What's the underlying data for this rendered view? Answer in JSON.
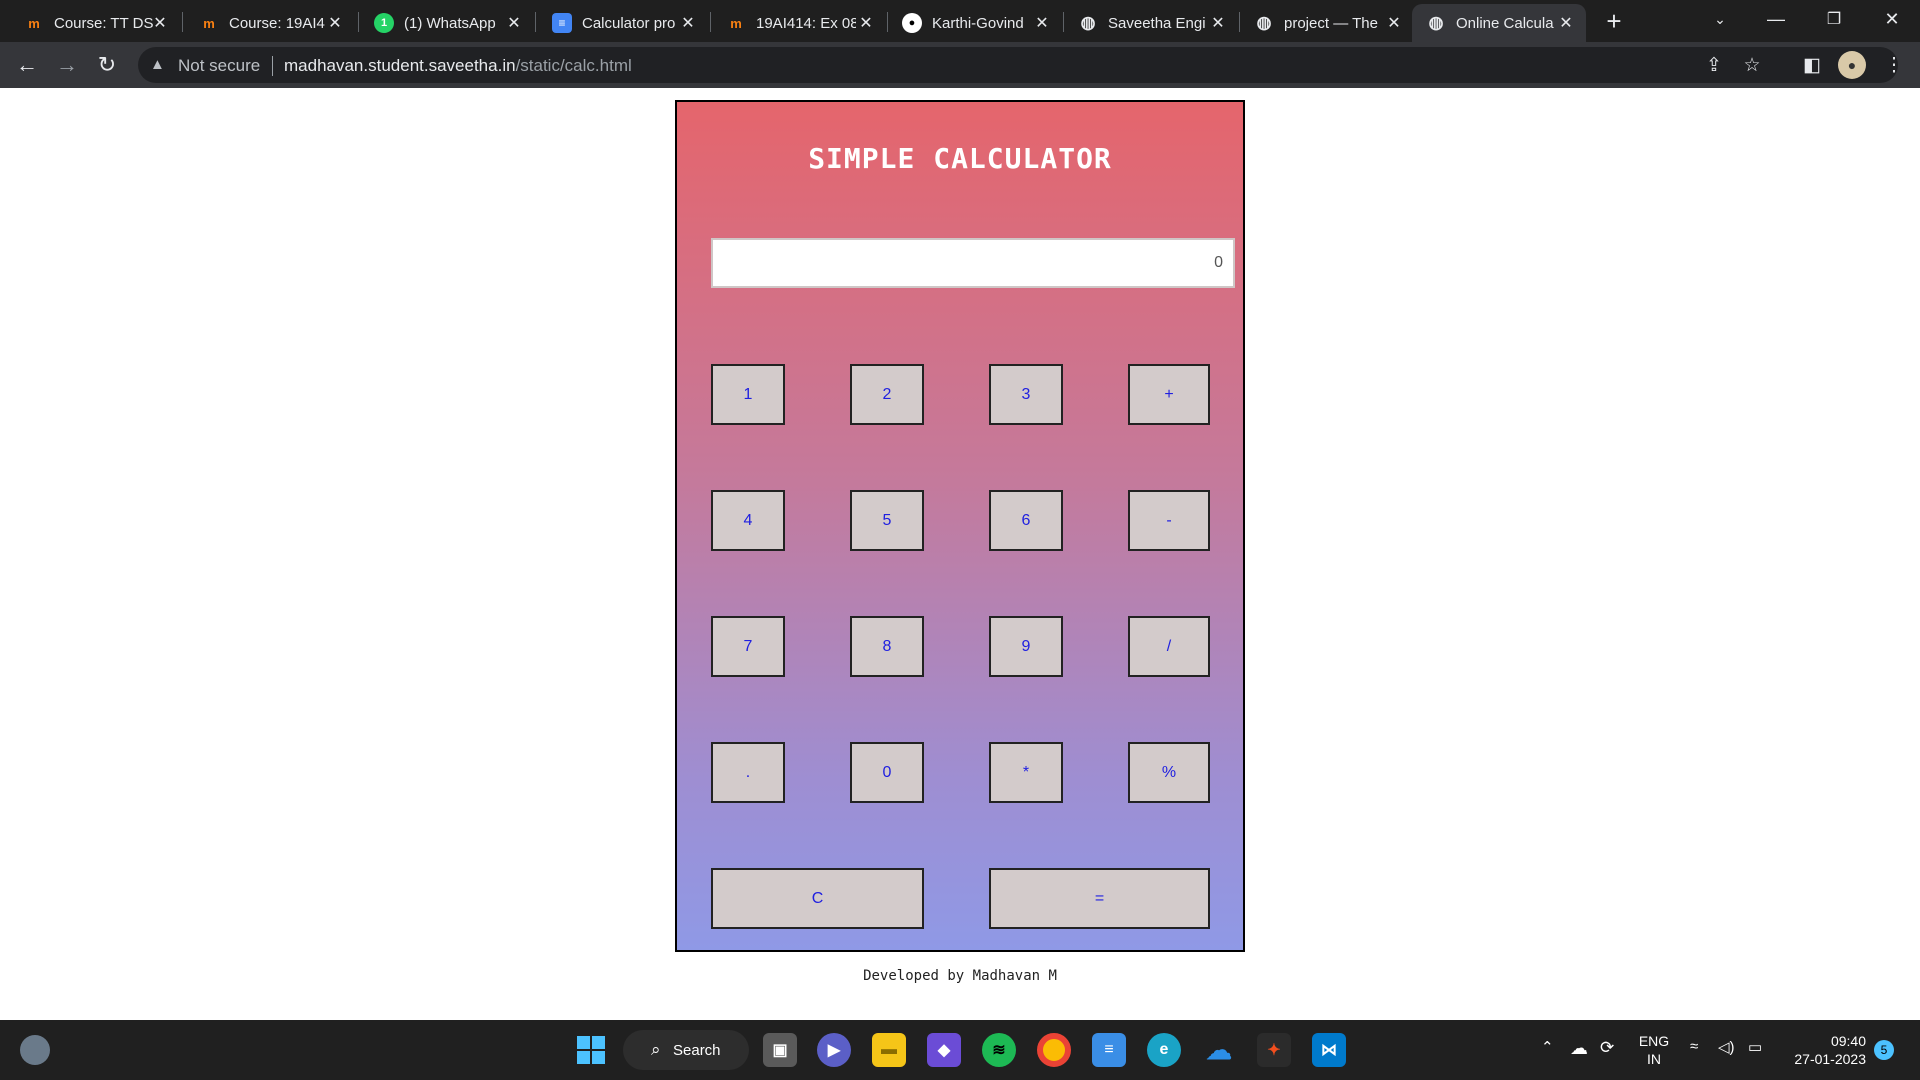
{
  "tabs": [
    {
      "label": "Course: TT DS",
      "icon": "moodle-icon",
      "color": "#f98012"
    },
    {
      "label": "Course: 19AI4",
      "icon": "moodle-icon",
      "color": "#f98012"
    },
    {
      "label": "(1) WhatsApp",
      "icon": "whatsapp-icon",
      "color": "#25d366",
      "badge": "1"
    },
    {
      "label": "Calculator pro",
      "icon": "docs-icon",
      "color": "#4285f4"
    },
    {
      "label": "19AI414: Ex 08",
      "icon": "moodle-icon",
      "color": "#f98012"
    },
    {
      "label": "Karthi-Govind",
      "icon": "github-icon",
      "color": "#ffffff"
    },
    {
      "label": "Saveetha Engi",
      "icon": "globe-icon",
      "color": "#e8eaed"
    },
    {
      "label": "project — The",
      "icon": "globe-icon",
      "color": "#e8eaed"
    },
    {
      "label": "Online Calcula",
      "icon": "globe-icon",
      "color": "#e8eaed",
      "active": true
    }
  ],
  "address": {
    "security": "Not secure",
    "host": "madhavan.student.saveetha.in",
    "path": "/static/calc.html"
  },
  "calculator": {
    "title": "SIMPLE CALCULATOR",
    "display_value": "0",
    "keys": [
      "1",
      "2",
      "3",
      "+",
      "4",
      "5",
      "6",
      "-",
      "7",
      "8",
      "9",
      "/",
      ".",
      "0",
      "*",
      "%"
    ],
    "clear_label": "C",
    "equals_label": "="
  },
  "footer": "Developed by Madhavan M",
  "taskbar": {
    "search_label": "Search",
    "lang_top": "ENG",
    "lang_bottom": "IN",
    "time": "09:40",
    "date": "27-01-2023",
    "notifications": "5"
  }
}
